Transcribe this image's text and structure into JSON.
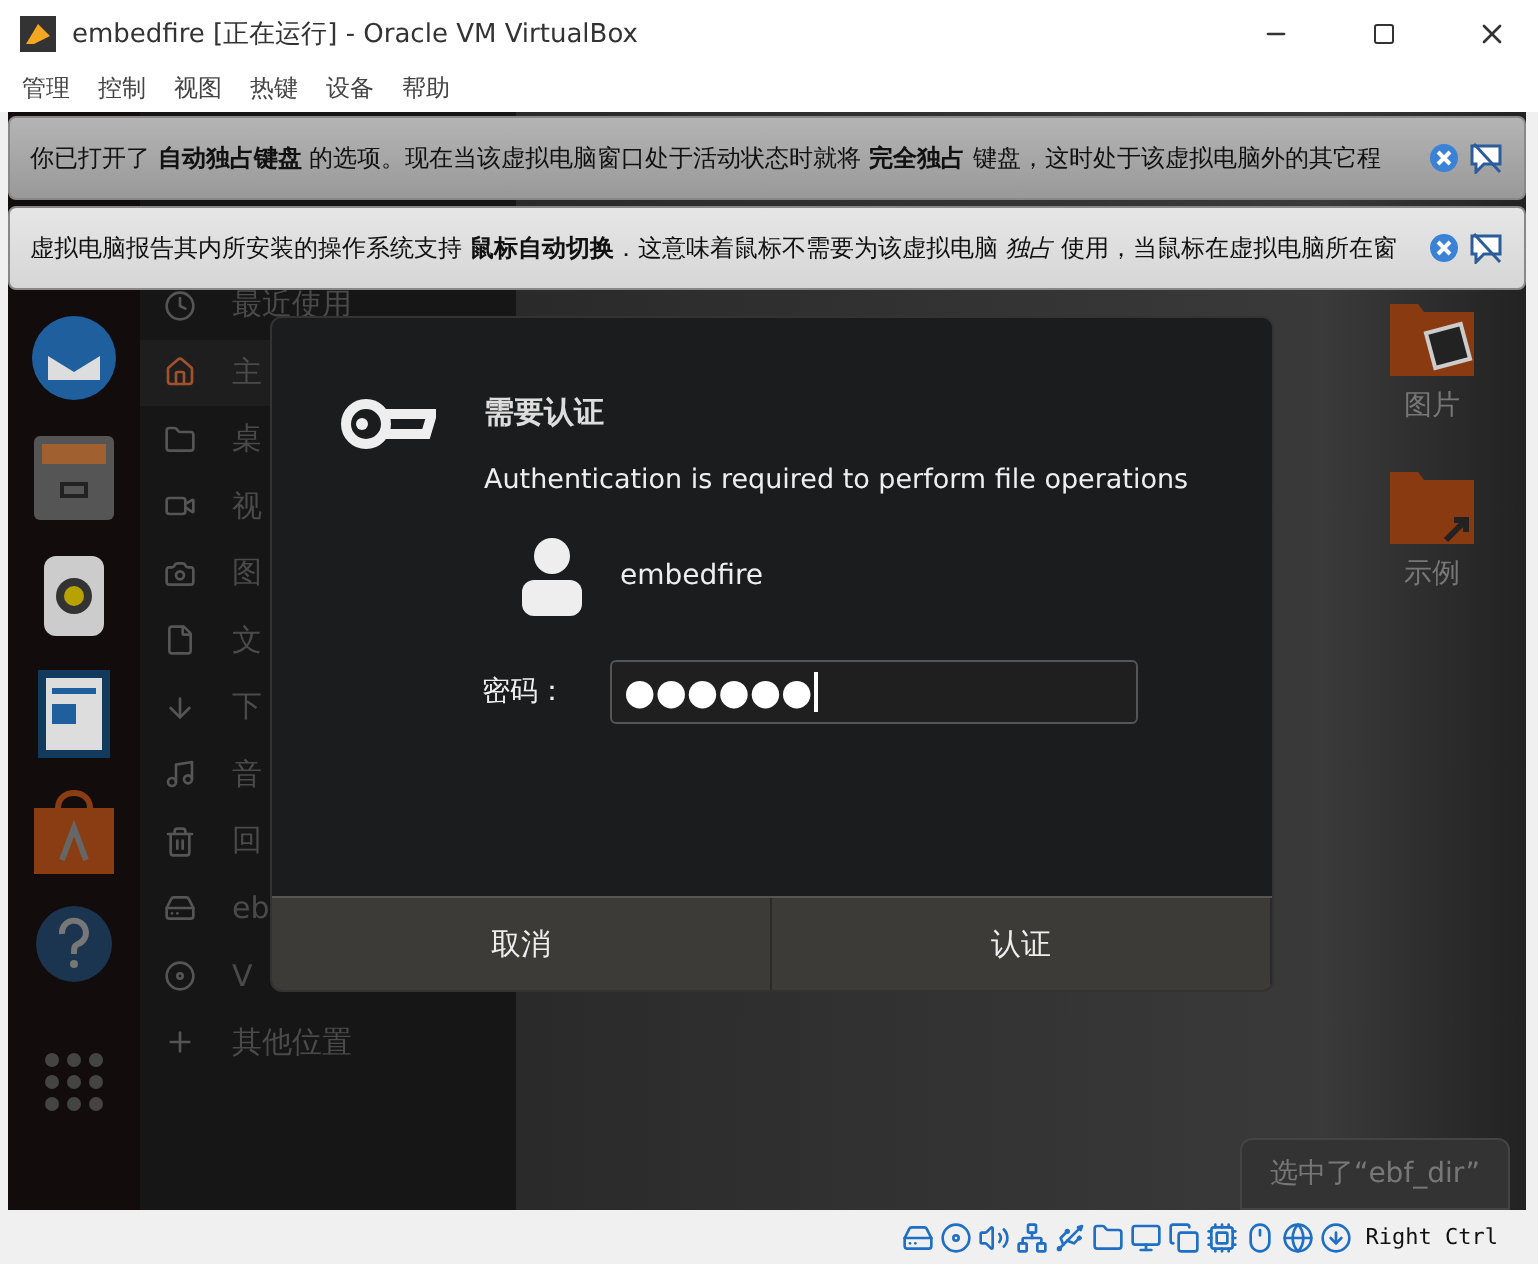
{
  "window": {
    "title": "embedfire [正在运行] - Oracle VM VirtualBox"
  },
  "menu": [
    "管理",
    "控制",
    "视图",
    "热键",
    "设备",
    "帮助"
  ],
  "notifications": [
    {
      "text": "你已打开了 **自动独占键盘** 的选项。现在当该虚拟电脑窗口处于活动状态时就将 **完全独占** 键盘，这时处于该虚拟电脑外的其它程",
      "kind": "dark"
    },
    {
      "text": "虚拟电脑报告其内所安装的操作系统支持 **鼠标自动切换**．这意味着鼠标不需要为该虚拟电脑 *独占* 使用，当鼠标在虚拟电脑所在窗",
      "kind": "light"
    }
  ],
  "sidebar": [
    {
      "kind": "recent",
      "label": "最近使用",
      "selected": false
    },
    {
      "kind": "home",
      "label": "主",
      "selected": true
    },
    {
      "kind": "folder",
      "label": "桌",
      "selected": false
    },
    {
      "kind": "video",
      "label": "视",
      "selected": false
    },
    {
      "kind": "camera",
      "label": "图",
      "selected": false
    },
    {
      "kind": "file",
      "label": "文",
      "selected": false
    },
    {
      "kind": "download",
      "label": "下",
      "selected": false
    },
    {
      "kind": "music",
      "label": "音",
      "selected": false
    },
    {
      "kind": "trash",
      "label": "回",
      "selected": false
    },
    {
      "kind": "drive",
      "label": "eb",
      "selected": false
    },
    {
      "kind": "disc",
      "label": "V",
      "selected": false
    },
    {
      "kind": "plus",
      "label": "其他位置",
      "selected": false
    }
  ],
  "files": [
    {
      "kind": "pictures",
      "label": "图片"
    },
    {
      "kind": "link",
      "label": "示例"
    }
  ],
  "dialog": {
    "title": "需要认证",
    "message": "Authentication is required to perform file operations",
    "user": "embedfire",
    "password": {
      "label": "密码：",
      "value": "●●●●●●"
    },
    "buttons": [
      "取消",
      "认证"
    ]
  },
  "toast": "选中了“ebf_dir”",
  "status_bar": {
    "host_key": "Right Ctrl"
  }
}
